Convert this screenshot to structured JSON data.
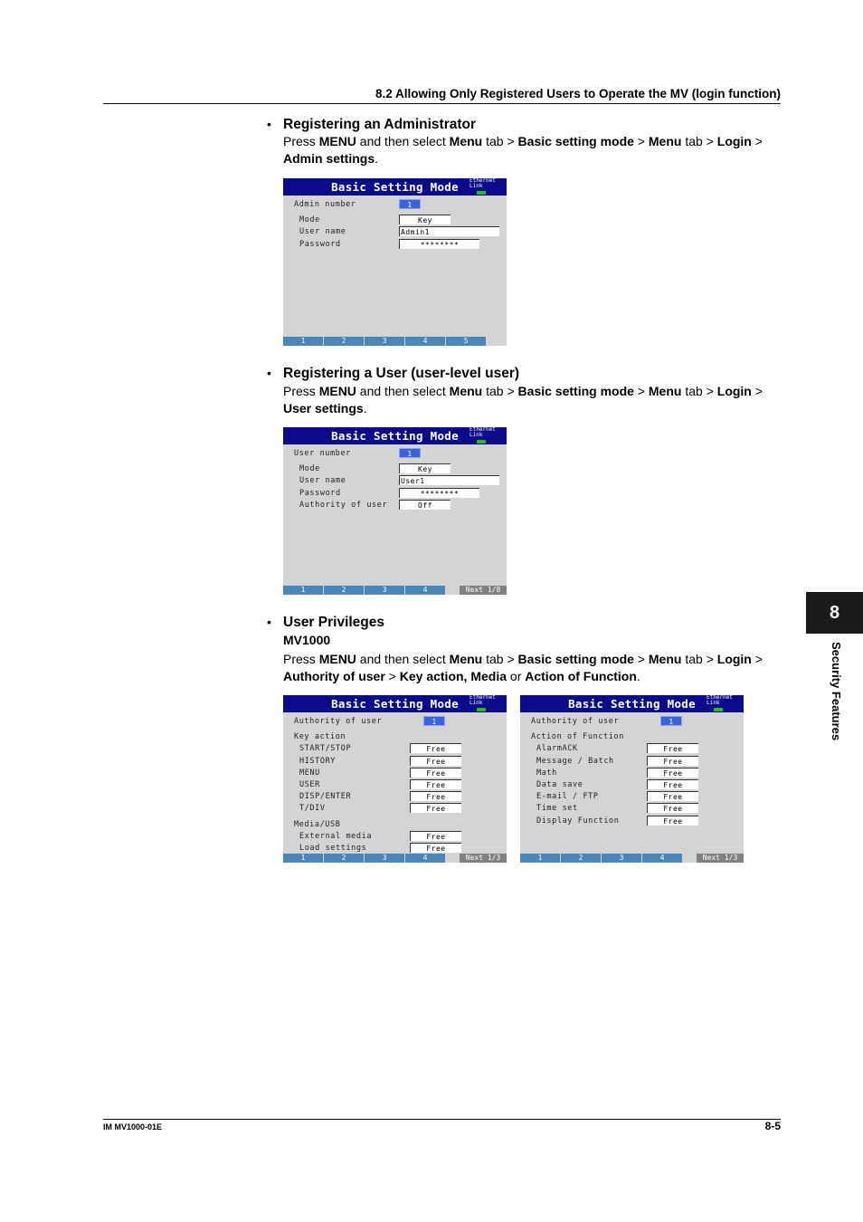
{
  "header": {
    "section": "8.2  Allowing Only Registered Users to Operate the MV (login function)"
  },
  "sections": [
    {
      "heading": "Registering an Administrator",
      "text": [
        "Press ",
        {
          "b": "MENU"
        },
        " and then select ",
        {
          "b": "Menu"
        },
        " tab > ",
        {
          "b": "Basic setting mode"
        },
        " > ",
        {
          "b": "Menu"
        },
        " tab > ",
        {
          "b": "Login"
        },
        " > ",
        {
          "b": "Admin settings"
        },
        "."
      ]
    },
    {
      "heading": "Registering a User (user-level user)",
      "text": [
        "Press ",
        {
          "b": "MENU"
        },
        " and then select ",
        {
          "b": "Menu"
        },
        " tab > ",
        {
          "b": "Basic setting mode"
        },
        " > ",
        {
          "b": "Menu"
        },
        " tab > ",
        {
          "b": "Login"
        },
        " > ",
        {
          "b": "User settings"
        },
        "."
      ]
    },
    {
      "heading": "User Privileges",
      "subheading": "MV1000",
      "text": [
        "Press ",
        {
          "b": "MENU"
        },
        " and then select ",
        {
          "b": "Menu"
        },
        " tab > ",
        {
          "b": "Basic setting mode"
        },
        " > ",
        {
          "b": "Menu"
        },
        " tab > ",
        {
          "b": "Login"
        },
        " > ",
        {
          "b": "Authority of user"
        },
        " > ",
        {
          "b": "Key action, Media"
        },
        " or ",
        {
          "b": "Action of Function"
        },
        "."
      ]
    }
  ],
  "bullet": "•",
  "screens": [
    {
      "title": "Basic Setting Mode",
      "ethernet": "Ethernet",
      "link": "Link",
      "rows": [
        {
          "label": "Admin number",
          "value": "1",
          "kind": "num"
        },
        {
          "label": "Mode",
          "value": "Key",
          "kind": "short",
          "indent": true
        },
        {
          "label": "User name",
          "value": "Admin1",
          "kind": "long",
          "indent": true
        },
        {
          "label": "Password",
          "value": "********",
          "kind": "medium",
          "indent": true
        }
      ],
      "softkeys": [
        "1",
        "2",
        "3",
        "4",
        "5"
      ]
    },
    {
      "title": "Basic Setting Mode",
      "ethernet": "Ethernet",
      "link": "Link",
      "rows": [
        {
          "label": "User number",
          "value": "1",
          "kind": "num"
        },
        {
          "label": "Mode",
          "value": "Key",
          "kind": "short",
          "indent": true
        },
        {
          "label": "User name",
          "value": "User1",
          "kind": "long",
          "indent": true
        },
        {
          "label": "Password",
          "value": "********",
          "kind": "medium",
          "indent": true
        },
        {
          "label": "Authority of user",
          "value": "Off",
          "kind": "short",
          "indent": true
        }
      ],
      "softkeys": [
        "1",
        "2",
        "3",
        "4"
      ],
      "next": "Next 1/8"
    },
    {
      "title": "Basic Setting Mode",
      "ethernet": "Ethernet",
      "link": "Link",
      "rows": [
        {
          "label": "Authority of user",
          "value": "1",
          "kind": "num"
        },
        {
          "label": "Key action"
        },
        {
          "label": "START/STOP",
          "value": "Free",
          "kind": "short",
          "indent": true
        },
        {
          "label": "HISTORY",
          "value": "Free",
          "kind": "short",
          "indent": true
        },
        {
          "label": "MENU",
          "value": "Free",
          "kind": "short",
          "indent": true
        },
        {
          "label": "USER",
          "value": "Free",
          "kind": "short",
          "indent": true
        },
        {
          "label": "DISP/ENTER",
          "value": "Free",
          "kind": "short",
          "indent": true
        },
        {
          "label": "T/DIV",
          "value": "Free",
          "kind": "short",
          "indent": true
        },
        {
          "label": "Media/USB"
        },
        {
          "label": "External media",
          "value": "Free",
          "kind": "short",
          "indent": true
        },
        {
          "label": "Load settings",
          "value": "Free",
          "kind": "short",
          "indent": true
        }
      ],
      "softkeys": [
        "1",
        "2",
        "3",
        "4"
      ],
      "next": "Next 1/3"
    },
    {
      "title": "Basic Setting Mode",
      "ethernet": "Ethernet",
      "link": "Link",
      "rows": [
        {
          "label": "Authority of user",
          "value": "1",
          "kind": "num"
        },
        {
          "label": "Action of Function"
        },
        {
          "label": "AlarmACK",
          "value": "Free",
          "kind": "short",
          "indent": true
        },
        {
          "label": "Message / Batch",
          "value": "Free",
          "kind": "short",
          "indent": true
        },
        {
          "label": "Math",
          "value": "Free",
          "kind": "short",
          "indent": true
        },
        {
          "label": "Data save",
          "value": "Free",
          "kind": "short",
          "indent": true
        },
        {
          "label": "E-mail / FTP",
          "value": "Free",
          "kind": "short",
          "indent": true
        },
        {
          "label": "Time set",
          "value": "Free",
          "kind": "short",
          "indent": true
        },
        {
          "label": "Display Function",
          "value": "Free",
          "kind": "short",
          "indent": true
        }
      ],
      "softkeys": [
        "1",
        "2",
        "3",
        "4"
      ],
      "next": "Next 1/3"
    }
  ],
  "side_tab": {
    "number": "8",
    "label": "Security Features"
  },
  "footer": {
    "doc_id": "IM MV1000-01E",
    "page": "8-5"
  },
  "colors": {
    "screen_title_bar": "#0a0a8a",
    "screen_bg": "#d4d4d4",
    "softkey": "#4a86b8",
    "number_field": "#3a63d8"
  }
}
